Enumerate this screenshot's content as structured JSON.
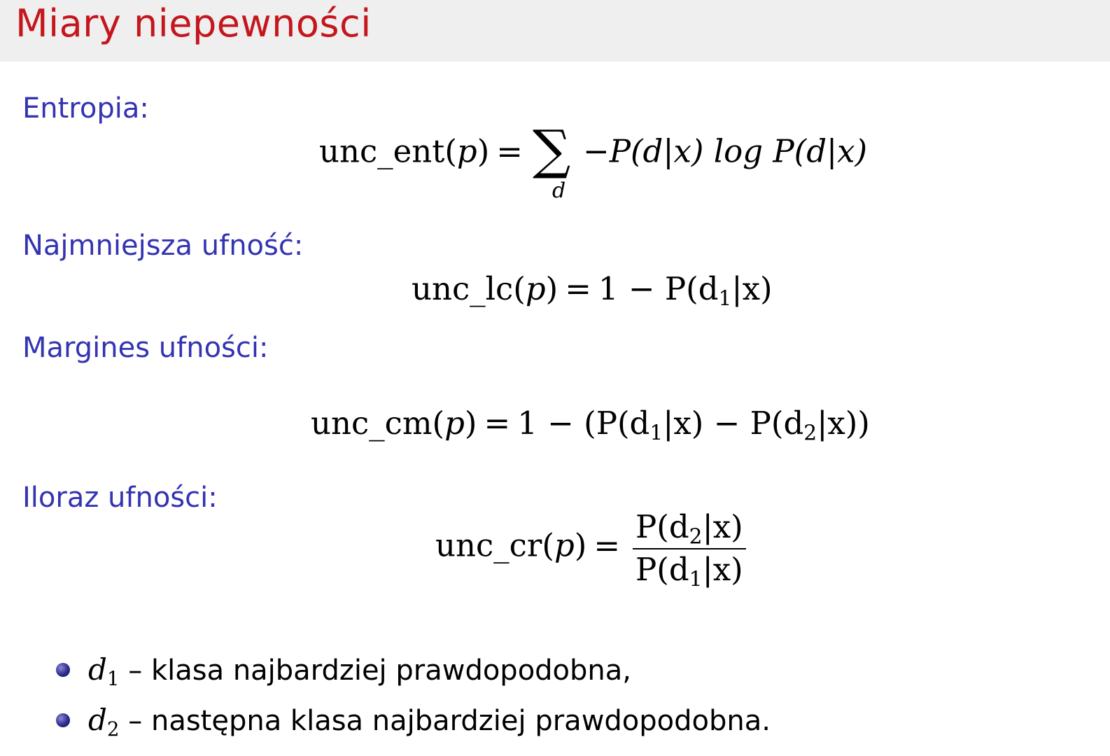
{
  "slide": {
    "title": "Miary niepewności"
  },
  "sections": [
    {
      "label": "Entropia:",
      "formula": {
        "lhs": "unc_ent(",
        "lhs_var": "p",
        "lhs_close": ")",
        "op": "=",
        "sigma": "∑",
        "sigma_sub": "d",
        "rhs": "−P(d|x) log P(d|x)"
      }
    },
    {
      "label": "Najmniejsza ufność:",
      "formula": {
        "lhs": "unc_lc(",
        "lhs_var": "p",
        "lhs_close": ")",
        "op": "=",
        "rhs_pre": "1 − P(d",
        "sub1": "1",
        "rhs_post": "|x)"
      }
    },
    {
      "label": "Margines ufności:",
      "formula": {
        "lhs": "unc_cm(",
        "lhs_var": "p",
        "lhs_close": ")",
        "op": "=",
        "rhs_a": "1 − (P(d",
        "sub1": "1",
        "rhs_b": "|x) − P(d",
        "sub2": "2",
        "rhs_c": "|x))"
      }
    },
    {
      "label": "Iloraz ufności:",
      "formula": {
        "lhs": "unc_cr(",
        "lhs_var": "p",
        "lhs_close": ")",
        "op": "=",
        "num_pre": "P(d",
        "num_sub": "2",
        "num_post": "|x)",
        "den_pre": "P(d",
        "den_sub": "1",
        "den_post": "|x)"
      }
    }
  ],
  "bullets": [
    {
      "var": "d",
      "sub": "1",
      "text": " – klasa najbardziej prawdopodobna,"
    },
    {
      "var": "d",
      "sub": "2",
      "text": " – następna klasa najbardziej prawdopodobna."
    }
  ],
  "colors": {
    "title": "#c4161c",
    "label": "#3333b3",
    "header_bg": "#efefef",
    "bullet": "#2b2b8c"
  }
}
